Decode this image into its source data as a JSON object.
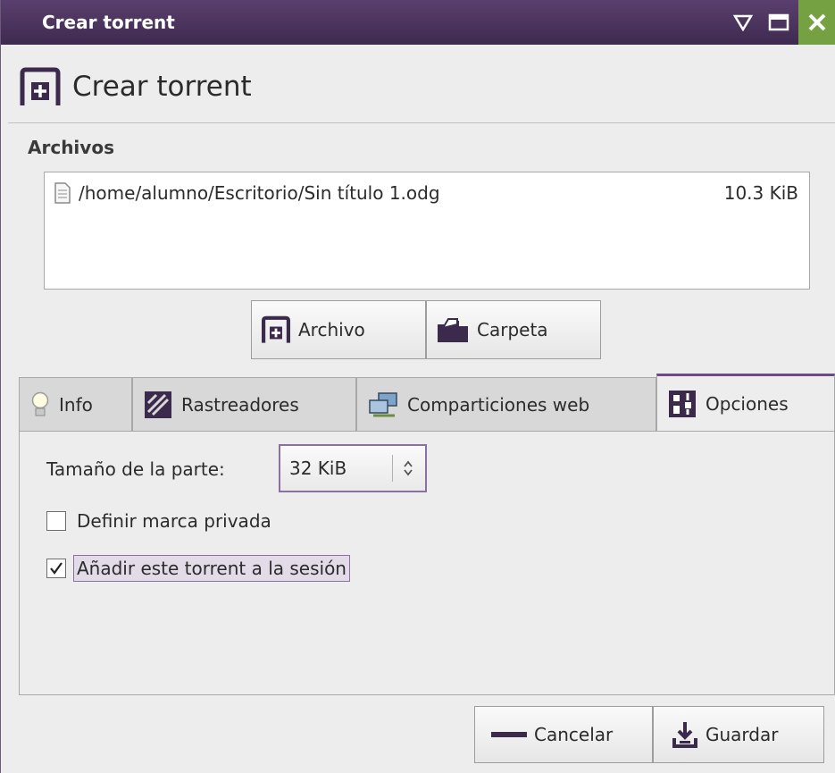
{
  "window": {
    "title": "Crear torrent"
  },
  "header": {
    "title": "Crear torrent",
    "icon": "add-file-icon"
  },
  "files": {
    "section_label": "Archivos",
    "items": [
      {
        "path": "/home/alumno/Escritorio/Sin título 1.odg",
        "size": "10.3 KiB",
        "icon": "document-icon"
      }
    ]
  },
  "add_buttons": {
    "archivo": "Archivo",
    "carpeta": "Carpeta"
  },
  "tabs": [
    {
      "label": "Info",
      "icon": "lightbulb-icon"
    },
    {
      "label": "Rastreadores",
      "icon": "trackers-icon"
    },
    {
      "label": "Comparticiones web",
      "icon": "network-icon"
    },
    {
      "label": "Opciones",
      "icon": "options-icon",
      "active": true
    }
  ],
  "options": {
    "piece_size_label": "Tamaño de la parte:",
    "piece_size_value": "32 KiB",
    "private_label": "Definir marca privada",
    "private_checked": false,
    "add_session_label": "Añadir este torrent a la sesión",
    "add_session_checked": true
  },
  "footer": {
    "cancel": "Cancelar",
    "save": "Guardar"
  },
  "colors": {
    "titlebar": "#4b3360",
    "close": "#76a142",
    "accent": "#6b4a86"
  }
}
